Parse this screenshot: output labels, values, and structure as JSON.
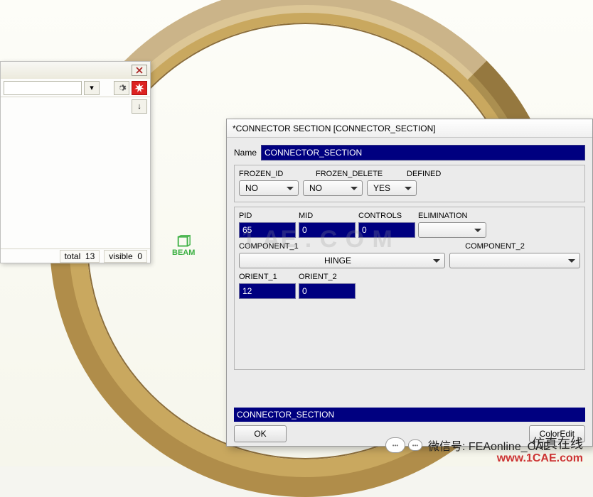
{
  "dialog": {
    "title": "*CONNECTOR SECTION [CONNECTOR_SECTION]",
    "name_label": "Name",
    "name_value": "CONNECTOR_SECTION",
    "frozen_id": {
      "label": "FROZEN_ID",
      "value": "NO"
    },
    "frozen_delete": {
      "label": "FROZEN_DELETE",
      "value": "NO"
    },
    "defined": {
      "label": "DEFINED",
      "value": "YES"
    },
    "pid": {
      "label": "PID",
      "value": "65"
    },
    "mid": {
      "label": "MID",
      "value": "0"
    },
    "controls": {
      "label": "CONTROLS",
      "value": "0"
    },
    "elimination": {
      "label": "ELIMINATION",
      "value": ""
    },
    "component_1": {
      "label": "COMPONENT_1",
      "value": "HINGE"
    },
    "component_2": {
      "label": "COMPONENT_2",
      "value": ""
    },
    "orient_1": {
      "label": "ORIENT_1",
      "value": "12"
    },
    "orient_2": {
      "label": "ORIENT_2",
      "value": "0"
    },
    "footer_bar": "CONNECTOR_SECTION",
    "ok": "OK",
    "coloredit": "ColorEdit"
  },
  "left_panel": {
    "status_total_label": "total",
    "status_total_value": "13",
    "status_visible_label": "visible",
    "status_visible_value": "0"
  },
  "beam": {
    "label": "BEAM"
  },
  "watermark": "1 AE . C O M",
  "footer": {
    "wechat": "微信号: FEAonline_CAE",
    "brand": "仿真在线",
    "url": "www.1CAE.com"
  }
}
